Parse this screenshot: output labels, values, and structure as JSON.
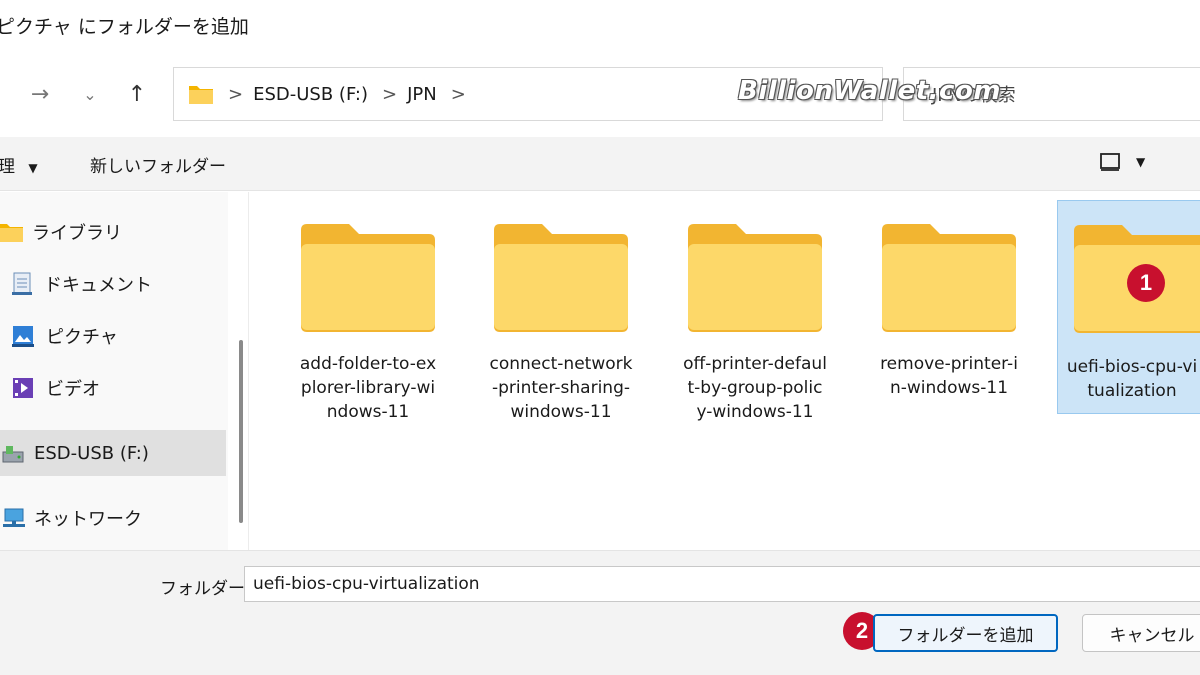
{
  "window": {
    "title": "ピクチャ にフォルダーを追加"
  },
  "nav": {
    "back_icon": "arrow-left-icon",
    "forward_icon": "arrow-right-icon",
    "recent_icon": "chevron-down-icon",
    "up_icon": "arrow-up-icon"
  },
  "address": {
    "crumbs": [
      "ESD-USB (F:)",
      "JPN"
    ],
    "separator": ">"
  },
  "search": {
    "placeholder": "JPNの検索"
  },
  "watermark": "BillionWallet.com",
  "toolbar": {
    "organize_label": "理",
    "new_folder_label": "新しいフォルダー"
  },
  "sidebar": {
    "items": [
      {
        "label": "ライブラリ",
        "icon": "folder-icon"
      },
      {
        "label": "ドキュメント",
        "icon": "document-icon"
      },
      {
        "label": "ピクチャ",
        "icon": "picture-icon"
      },
      {
        "label": "ビデオ",
        "icon": "video-icon"
      },
      {
        "label": "ESD-USB (F:)",
        "icon": "usb-drive-icon",
        "selected": true
      },
      {
        "label": "ネットワーク",
        "icon": "network-icon"
      }
    ]
  },
  "folders": [
    {
      "name": "add-folder-to-explorer-library-windows-11",
      "lines": [
        "add-folder-to-ex",
        "plorer-library-wi",
        "ndows-11"
      ]
    },
    {
      "name": "connect-network-printer-sharing-windows-11",
      "lines": [
        "connect-network",
        "-printer-sharing-",
        "windows-11"
      ]
    },
    {
      "name": "off-printer-default-by-group-policy-windows-11",
      "lines": [
        "off-printer-defaul",
        "t-by-group-polic",
        "y-windows-11"
      ]
    },
    {
      "name": "remove-printer-in-windows-11",
      "lines": [
        "remove-printer-i",
        "n-windows-11"
      ]
    },
    {
      "name": "uefi-bios-cpu-virtualization",
      "lines": [
        "uefi-bios-cpu-vi",
        "tualization"
      ],
      "selected": true
    }
  ],
  "footer": {
    "folder_label": "フォルダー:",
    "folder_value": "uefi-bios-cpu-virtualization",
    "add_button": "フォルダーを追加",
    "cancel_button": "キャンセル"
  },
  "annotations": {
    "step1": "1",
    "step2": "2"
  },
  "colors": {
    "accent": "#0067c0",
    "badge": "#c8102e",
    "folder": "#f9c83e",
    "selection": "#cce4f7"
  }
}
